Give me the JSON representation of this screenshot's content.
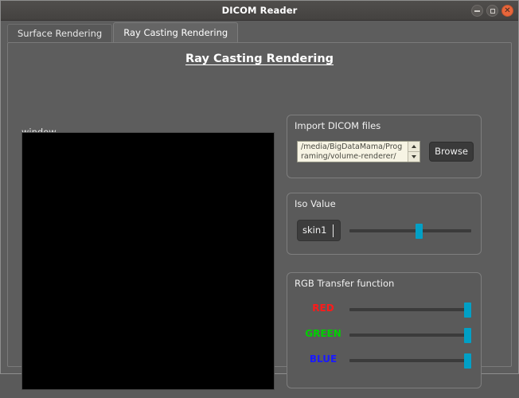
{
  "window": {
    "title": "DICOM Reader",
    "controls": {
      "minimize": "minimize-icon",
      "maximize": "maximize-icon",
      "close": "close-icon"
    }
  },
  "tabs": [
    {
      "label": "Surface Rendering",
      "active": false
    },
    {
      "label": "Ray Casting Rendering",
      "active": true
    }
  ],
  "main": {
    "page_title": "Ray Casting Rendering",
    "viewport_label": "window",
    "viewport_color": "#000000"
  },
  "import_group": {
    "title": "Import DICOM files",
    "path_value": "/media/BigDataMama/Programing/volume-renderer/",
    "spin_up": "spin-up-arrow",
    "spin_down": "spin-down-arrow",
    "browse_label": "Browse"
  },
  "iso_group": {
    "title": "Iso Value",
    "field_value": "skin1",
    "slider_percent": 57
  },
  "rgb_group": {
    "title": "RGB Transfer function",
    "channels": [
      {
        "label": "RED",
        "color": "#ff1a1a",
        "percent": 100
      },
      {
        "label": "GREEN",
        "color": "#00d000",
        "percent": 100
      },
      {
        "label": "BLUE",
        "color": "#1a1aff",
        "percent": 100
      }
    ]
  },
  "theme": {
    "window_bg": "#5d5d5d",
    "titlebar_bg": "#4a4846",
    "accent": "#00a0c6",
    "field_bg": "#f7f4e4",
    "button_bg": "#3a3a3a"
  }
}
